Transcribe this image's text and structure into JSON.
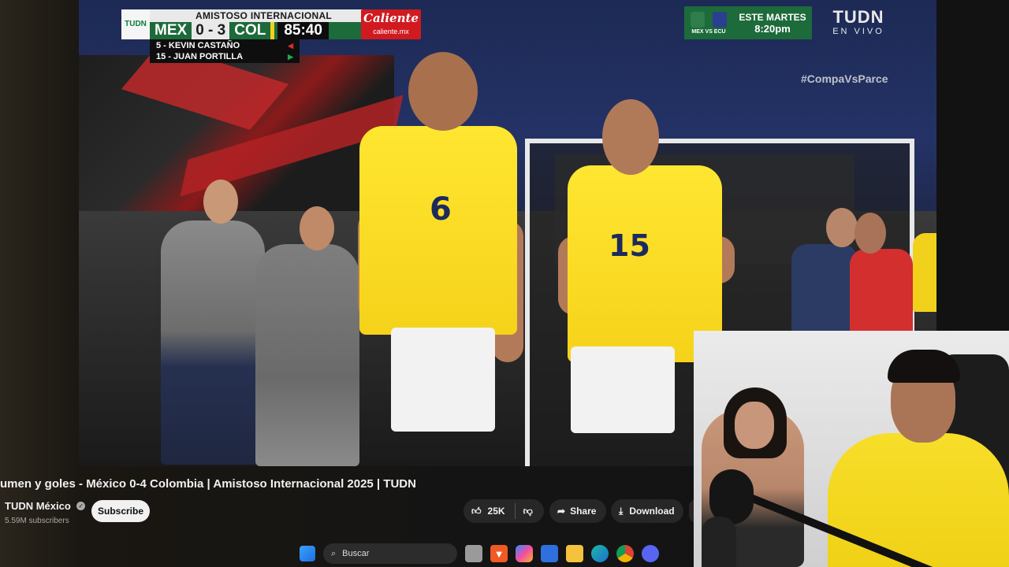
{
  "scoreboard": {
    "competition": "AMISTOSO INTERNACIONAL",
    "broadcaster_logo": "TUDN",
    "home_team": "MEX",
    "home_score": "0",
    "separator": "-",
    "away_score": "3",
    "away_team": "COL",
    "match_time": "85:40",
    "sponsor_name": "Caliente",
    "sponsor_url": "caliente.mx",
    "substitutions": [
      {
        "text": "5 - KEVIN CASTAÑO",
        "direction": "out"
      },
      {
        "text": "15 - JUAN PORTILLA",
        "direction": "in"
      }
    ]
  },
  "promo": {
    "teams": "MEX VS ECU",
    "day": "ESTE MARTES",
    "time": "8:20pm"
  },
  "channel_bug": {
    "name": "TUDN",
    "status": "EN VIVO"
  },
  "hashtag": "#CompaVsParce",
  "jersey_numbers": [
    "6",
    "15"
  ],
  "video": {
    "title": "umen y goles - México 0-4 Colombia | Amistoso Internacional 2025 | TUDN",
    "channel_name": "TUDN México",
    "subscribers": "5.59M subscribers",
    "subscribe_label": "Subscribe",
    "like_count": "25K",
    "share_label": "Share",
    "download_label": "Download"
  },
  "taskbar": {
    "search_placeholder": "Buscar",
    "apps": [
      "windows-start",
      "search",
      "task-view",
      "brave",
      "copilot",
      "store",
      "file-explorer",
      "edge",
      "chrome",
      "discord"
    ]
  },
  "colors": {
    "scoreboard_green": "#1d6a3a",
    "sponsor_red": "#d01a20",
    "colombia_yellow": "#ffe631",
    "youtube_dark": "#0f0f0f"
  }
}
